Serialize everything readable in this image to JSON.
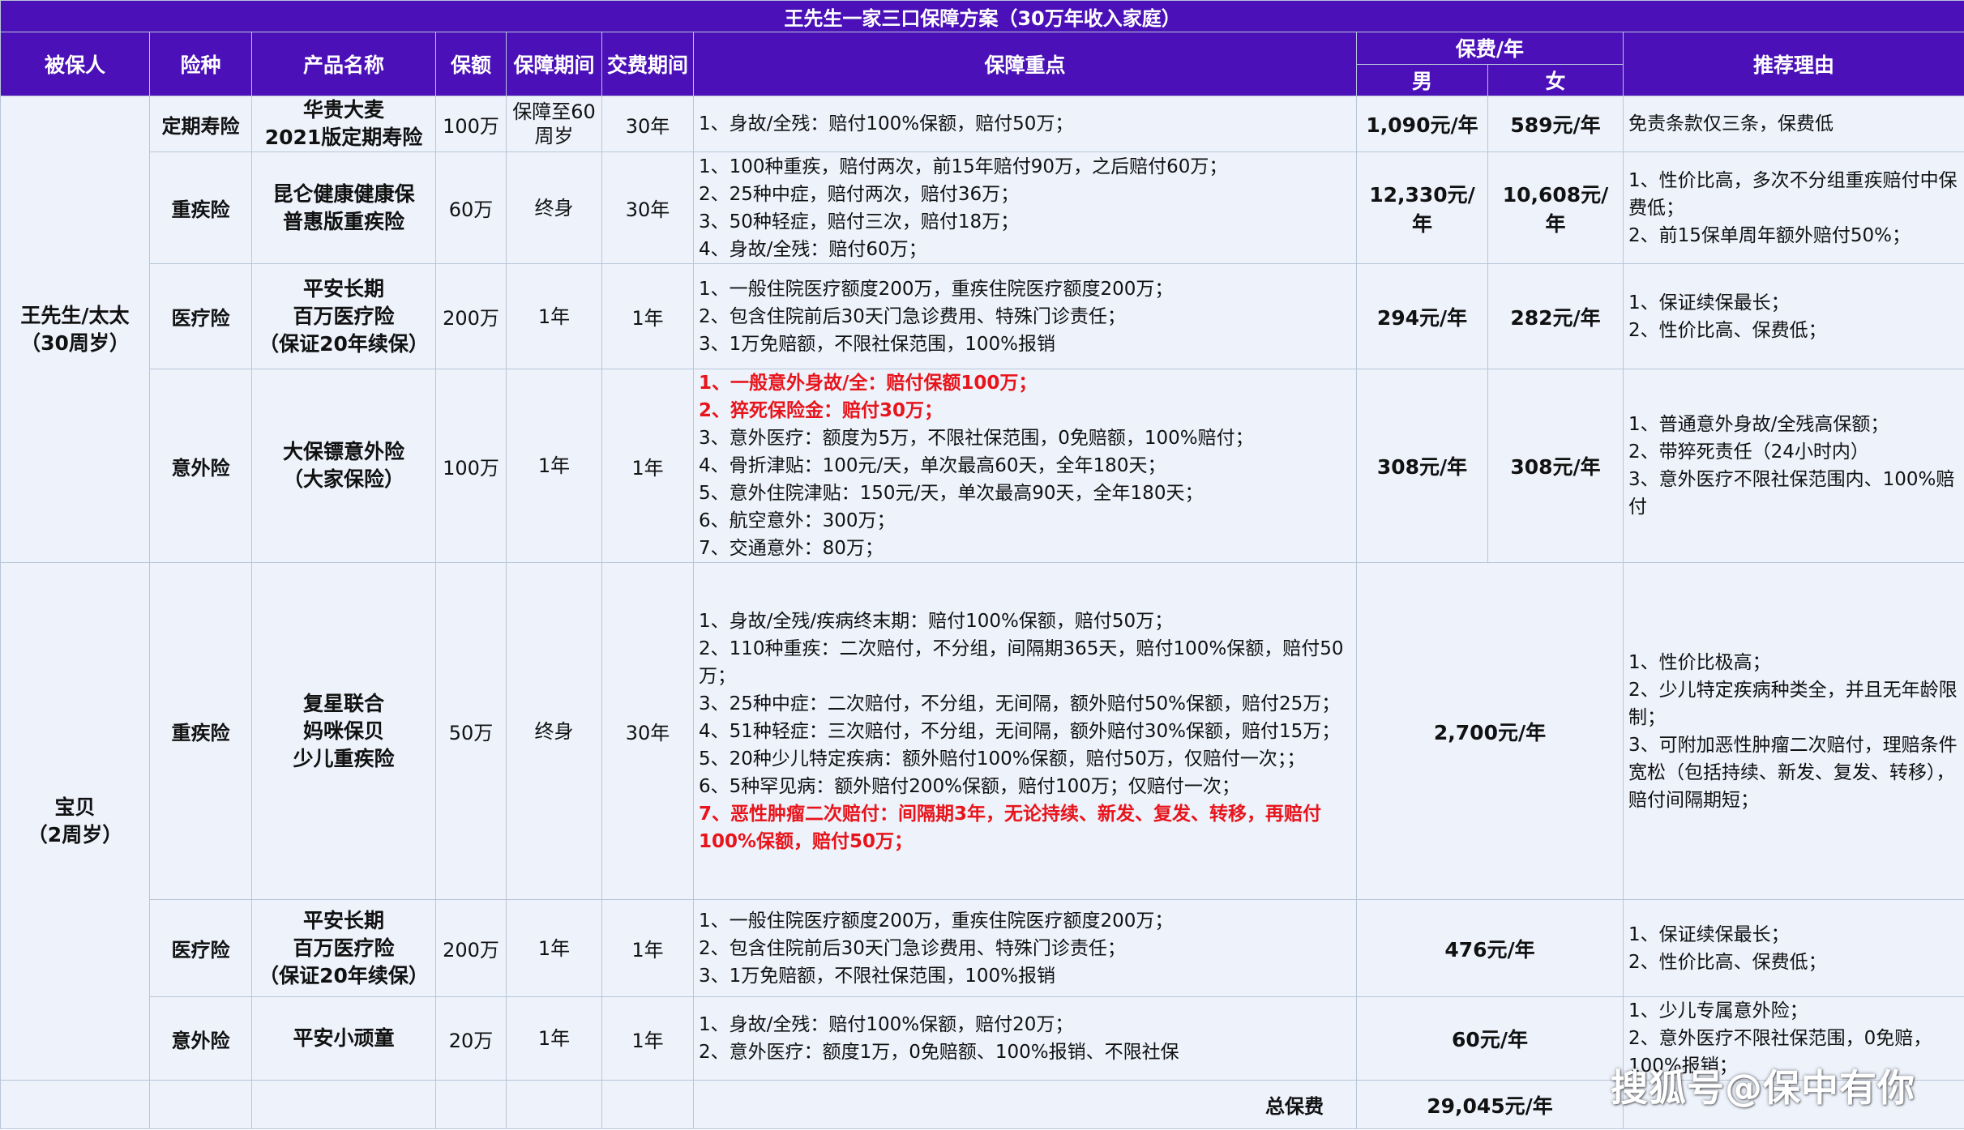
{
  "title": "王先生一家三口保障方案（30万年收入家庭）",
  "headers": {
    "insured": "被保人",
    "type": "险种",
    "product": "产品名称",
    "amount": "保额",
    "period": "保障期间",
    "pay_period": "交费期间",
    "features": "保障重点",
    "premium": "保费/年",
    "male": "男",
    "female": "女",
    "reason": "推荐理由"
  },
  "adults": {
    "insured": [
      "王先生/太太",
      "（30周岁）"
    ],
    "rows": [
      {
        "type": "定期寿险",
        "product": [
          "华贵大麦",
          "2021版定期寿险"
        ],
        "amount": "100万",
        "period": [
          "保障至60",
          "周岁"
        ],
        "pay_period": "30年",
        "features": [
          {
            "text": "1、身故/全残：赔付100%保额，赔付50万；",
            "red": false
          }
        ],
        "premium_male": "1,090元/年",
        "premium_female": "589元/年",
        "reason": [
          "免责条款仅三条，保费低"
        ]
      },
      {
        "type": "重疾险",
        "product": [
          "昆仑健康健康保",
          "普惠版重疾险"
        ],
        "amount": "60万",
        "period": [
          "终身"
        ],
        "pay_period": "30年",
        "features": [
          {
            "text": "1、100种重疾，赔付两次，前15年赔付90万，之后赔付60万；",
            "red": false
          },
          {
            "text": "2、25种中症，赔付两次，赔付36万；",
            "red": false
          },
          {
            "text": "3、50种轻症，赔付三次，赔付18万；",
            "red": false
          },
          {
            "text": "4、身故/全残：赔付60万；",
            "red": false
          }
        ],
        "premium_male": "12,330元/年",
        "premium_female": "10,608元/年",
        "reason": [
          "1、性价比高，多次不分组重疾赔付中保费低；",
          "2、前15保单周年额外赔付50%；"
        ]
      },
      {
        "type": "医疗险",
        "product": [
          "平安长期",
          "百万医疗险",
          "（保证20年续保）"
        ],
        "amount": "200万",
        "period": [
          "1年"
        ],
        "pay_period": "1年",
        "features": [
          {
            "text": "1、一般住院医疗额度200万，重疾住院医疗额度200万；",
            "red": false
          },
          {
            "text": "2、包含住院前后30天门急诊费用、特殊门诊责任；",
            "red": false
          },
          {
            "text": "3、1万免赔额，不限社保范围，100%报销",
            "red": false
          }
        ],
        "premium_male": "294元/年",
        "premium_female": "282元/年",
        "reason": [
          "1、保证续保最长；",
          "2、性价比高、保费低；"
        ]
      },
      {
        "type": "意外险",
        "product": [
          "大保镖意外险",
          "（大家保险）"
        ],
        "amount": "100万",
        "period": [
          "1年"
        ],
        "pay_period": "1年",
        "features": [
          {
            "text": "1、一般意外身故/全：赔付保额100万；",
            "red": true
          },
          {
            "text": "2、猝死保险金：赔付30万；",
            "red": true
          },
          {
            "text": "3、意外医疗：额度为5万，不限社保范围，0免赔额，100%赔付；",
            "red": false
          },
          {
            "text": "4、骨折津贴：100元/天，单次最高60天，全年180天；",
            "red": false
          },
          {
            "text": "5、意外住院津贴：150元/天，单次最高90天，全年180天；",
            "red": false
          },
          {
            "text": "6、航空意外：300万；",
            "red": false
          },
          {
            "text": "7、交通意外：80万；",
            "red": false
          }
        ],
        "premium_male": "308元/年",
        "premium_female": "308元/年",
        "reason": [
          "1、普通意外身故/全残高保额；",
          "2、带猝死责任（24小时内）",
          "3、意外医疗不限社保范围内、100%赔付"
        ]
      }
    ]
  },
  "baby": {
    "insured": [
      "宝贝",
      "（2周岁）"
    ],
    "rows": [
      {
        "type": "重疾险",
        "product": [
          "复星联合",
          "妈咪保贝",
          "少儿重疾险"
        ],
        "amount": "50万",
        "period": [
          "终身"
        ],
        "pay_period": "30年",
        "features": [
          {
            "text": "1、身故/全残/疾病终末期：赔付100%保额，赔付50万；",
            "red": false
          },
          {
            "text": "2、110种重疾：二次赔付，不分组，间隔期365天，赔付100%保额，赔付50万；",
            "red": false
          },
          {
            "text": "3、25种中症：二次赔付，不分组，无间隔，额外赔付50%保额，赔付25万；",
            "red": false
          },
          {
            "text": "4、51种轻症：三次赔付，不分组，无间隔，额外赔付30%保额，赔付15万；",
            "red": false
          },
          {
            "text": "5、20种少儿特定疾病：额外赔付100%保额，赔付50万，仅赔付一次；；",
            "red": false
          },
          {
            "text": "6、5种罕见病：额外赔付200%保额，赔付100万；仅赔付一次；",
            "red": false
          },
          {
            "text": "7、恶性肿瘤二次赔付：间隔期3年，无论持续、新发、复发、转移，再赔付100%保额，赔付50万；",
            "red": true
          }
        ],
        "premium": "2,700元/年",
        "reason": [
          "1、性价比极高；",
          "2、少儿特定疾病种类全，并且无年龄限制；",
          "3、可附加恶性肿瘤二次赔付，理赔条件宽松（包括持续、新发、复发、转移），赔付间隔期短；"
        ]
      },
      {
        "type": "医疗险",
        "product": [
          "平安长期",
          "百万医疗险",
          "（保证20年续保）"
        ],
        "amount": "200万",
        "period": [
          "1年"
        ],
        "pay_period": "1年",
        "features": [
          {
            "text": "1、一般住院医疗额度200万，重疾住院医疗额度200万；",
            "red": false
          },
          {
            "text": "2、包含住院前后30天门急诊费用、特殊门诊责任；",
            "red": false
          },
          {
            "text": "3、1万免赔额，不限社保范围，100%报销",
            "red": false
          }
        ],
        "premium": "476元/年",
        "reason": [
          "1、保证续保最长；",
          "2、性价比高、保费低；"
        ]
      },
      {
        "type": "意外险",
        "product": [
          "平安小顽童"
        ],
        "amount": "20万",
        "period": [
          "1年"
        ],
        "pay_period": "1年",
        "features": [
          {
            "text": "1、身故/全残：赔付100%保额，赔付20万；",
            "red": false
          },
          {
            "text": "2、意外医疗：额度1万，0免赔额、100%报销、不限社保",
            "red": false
          }
        ],
        "premium": "60元/年",
        "reason": [
          "1、少儿专属意外险；",
          "2、意外医疗不限社保范围，0免赔，100%报销；"
        ]
      }
    ]
  },
  "total": {
    "label": "总保费",
    "value": "29,045元/年"
  },
  "watermark": "搜狐号@保中有你",
  "colors": {
    "header_bg": "#4b10b8",
    "body_bg": "#edf2fb",
    "highlight_red": "#e8141b"
  }
}
